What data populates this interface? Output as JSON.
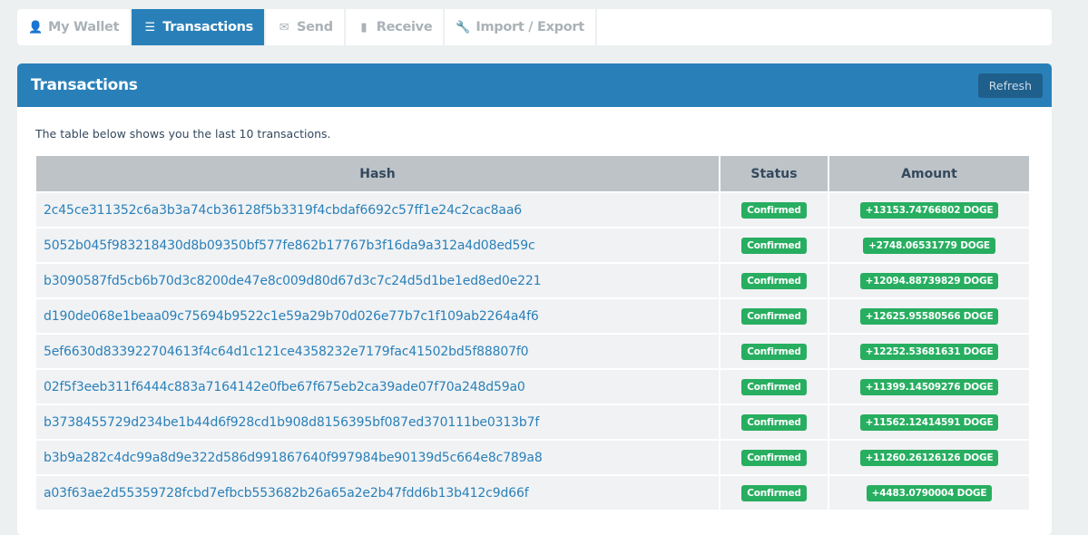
{
  "nav": {
    "tabs": [
      {
        "label": "My Wallet",
        "icon": "user-icon",
        "glyph": "👤"
      },
      {
        "label": "Transactions",
        "icon": "list-icon",
        "glyph": "☰"
      },
      {
        "label": "Send",
        "icon": "envelope-icon",
        "glyph": "✉"
      },
      {
        "label": "Receive",
        "icon": "book-icon",
        "glyph": "▮"
      },
      {
        "label": "Import / Export",
        "icon": "wrench-icon",
        "glyph": "🔧"
      }
    ],
    "active": 1
  },
  "panel": {
    "title": "Transactions",
    "refresh_label": "Refresh",
    "intro": "The table below shows you the last 10 transactions."
  },
  "table": {
    "headers": [
      "Hash",
      "Status",
      "Amount"
    ],
    "rows": [
      {
        "hash": "2c45ce311352c6a3b3a74cb36128f5b3319f4cbdaf6692c57ff1e24c2cac8aa6",
        "status": "Confirmed",
        "amount": "+13153.74766802 DOGE"
      },
      {
        "hash": "5052b045f983218430d8b09350bf577fe862b17767b3f16da9a312a4d08ed59c",
        "status": "Confirmed",
        "amount": "+2748.06531779 DOGE"
      },
      {
        "hash": "b3090587fd5cb6b70d3c8200de47e8c009d80d67d3c7c24d5d1be1ed8ed0e221",
        "status": "Confirmed",
        "amount": "+12094.88739829 DOGE"
      },
      {
        "hash": "d190de068e1beaa09c75694b9522c1e59a29b70d026e77b7c1f109ab2264a4f6",
        "status": "Confirmed",
        "amount": "+12625.95580566 DOGE"
      },
      {
        "hash": "5ef6630d833922704613f4c64d1c121ce4358232e7179fac41502bd5f88807f0",
        "status": "Confirmed",
        "amount": "+12252.53681631 DOGE"
      },
      {
        "hash": "02f5f3eeb311f6444c883a7164142e0fbe67f675eb2ca39ade07f70a248d59a0",
        "status": "Confirmed",
        "amount": "+11399.14509276 DOGE"
      },
      {
        "hash": "b3738455729d234be1b44d6f928cd1b908d8156395bf087ed370111be0313b7f",
        "status": "Confirmed",
        "amount": "+11562.12414591 DOGE"
      },
      {
        "hash": "b3b9a282c4dc99a8d9e322d586d991867640f997984be90139d5c664e8c789a8",
        "status": "Confirmed",
        "amount": "+11260.26126126 DOGE"
      },
      {
        "hash": "a03f63ae2d55359728fcbd7efbcb553682b26a65a2e2b47fdd6b13b412c9d66f",
        "status": "Confirmed",
        "amount": "+4483.0790004 DOGE"
      }
    ]
  },
  "colors": {
    "primary": "#2980b9",
    "success": "#27ae60"
  }
}
